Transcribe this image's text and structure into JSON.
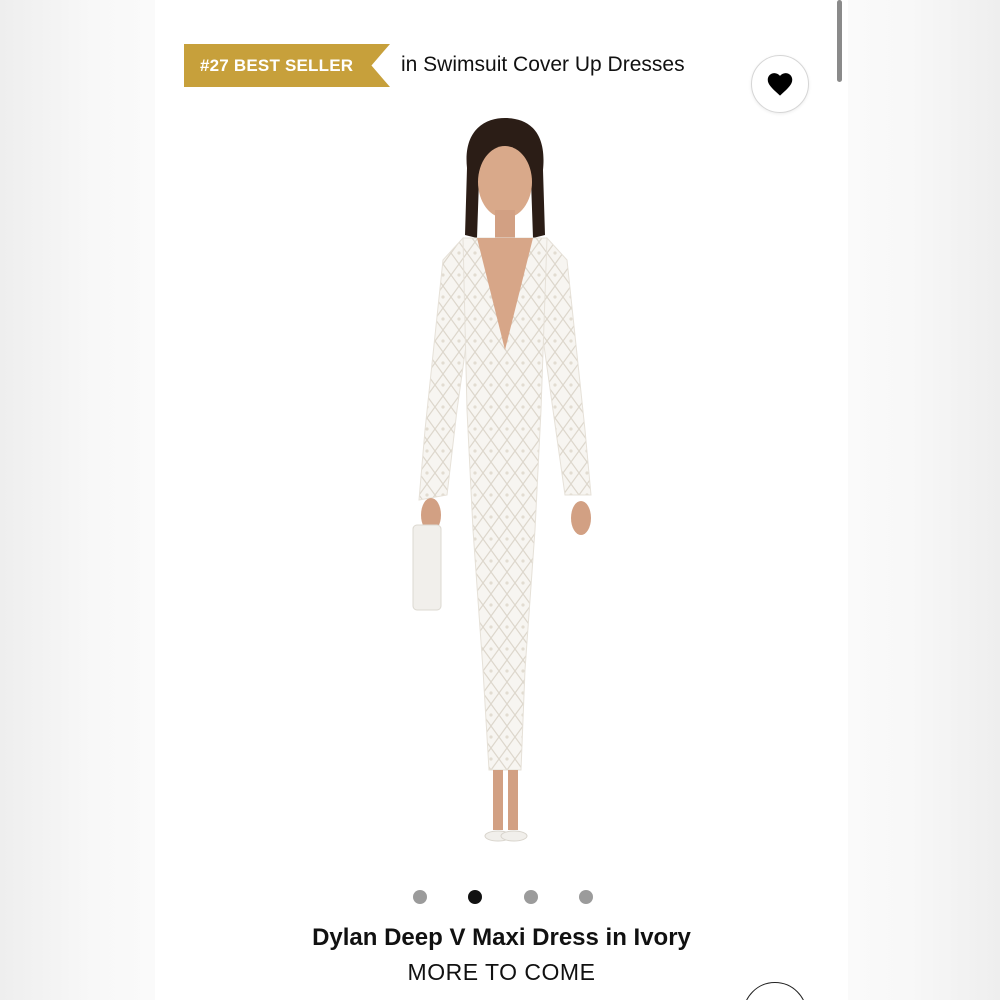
{
  "badge": {
    "rank_label": "#27 BEST SELLER",
    "category": "in Swimsuit Cover Up Dresses",
    "color": "#c7a03b"
  },
  "favorite": {
    "icon": "heart-icon",
    "filled": true
  },
  "gallery": {
    "image_count": 4,
    "active_index": 1
  },
  "product": {
    "title": "Dylan Deep V Maxi Dress in Ivory",
    "brand": "MORE TO COME"
  }
}
